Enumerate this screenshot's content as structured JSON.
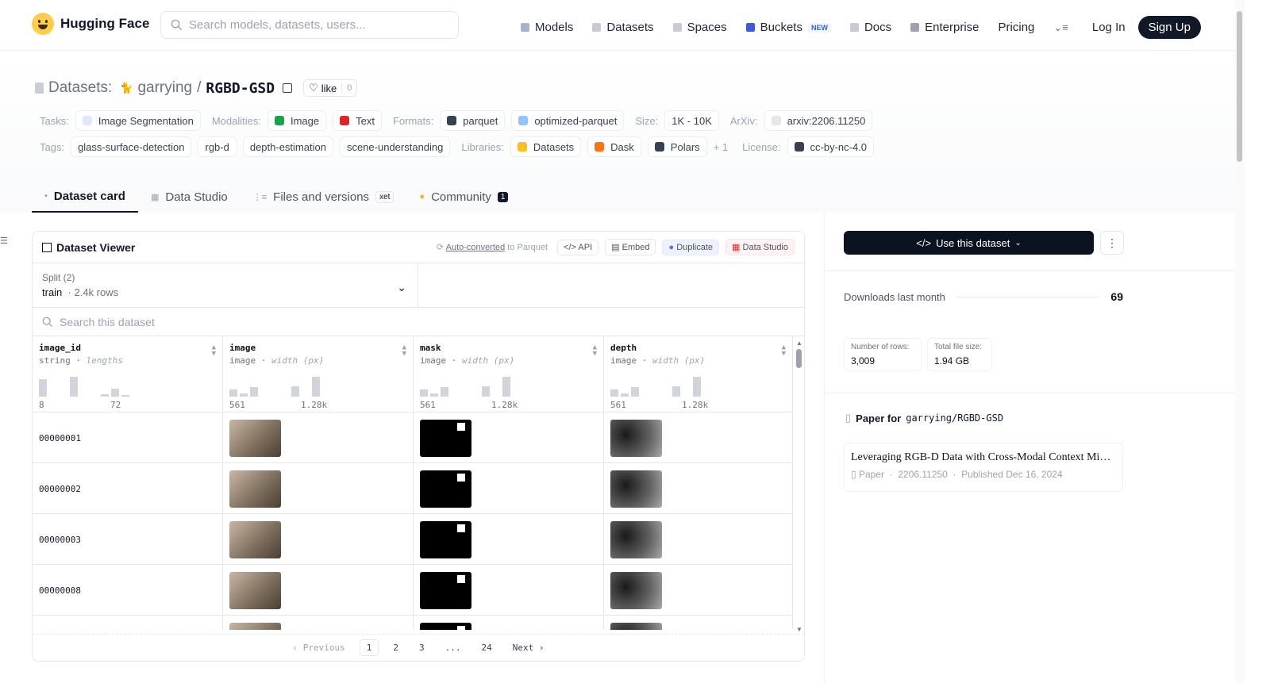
{
  "nav": {
    "brand": "Hugging Face",
    "search_placeholder": "Search models, datasets, users...",
    "links": [
      {
        "label": "Models",
        "icon": "cube-icon",
        "color": "#a5b4c8"
      },
      {
        "label": "Datasets",
        "icon": "database-icon",
        "color": "#c7cbd3"
      },
      {
        "label": "Spaces",
        "icon": "grid-icon",
        "color": "#c7cbd3"
      },
      {
        "label": "Buckets",
        "icon": "bucket-icon",
        "color": "#3b5bdb",
        "badge": "NEW"
      },
      {
        "label": "Docs",
        "icon": "book-icon",
        "color": "#c7cbd3"
      },
      {
        "label": "Enterprise",
        "icon": "briefcase-icon",
        "color": "#9ca3af"
      },
      {
        "label": "Pricing"
      }
    ],
    "more_label": "⌄≡",
    "login": "Log In",
    "signup": "Sign Up"
  },
  "header": {
    "datasets_label": "Datasets:",
    "owner": "garrying",
    "separator": "/",
    "name": "RGBD-GSD",
    "like_label": "like",
    "like_count": "0",
    "row1": [
      {
        "label": "Tasks:",
        "chips": [
          {
            "text": "Image Segmentation",
            "color": "#e0e7ff",
            "icon": "segmentation-icon"
          }
        ]
      },
      {
        "label": "Modalities:",
        "chips": [
          {
            "text": "Image",
            "color": "#16a34a",
            "icon": "image-icon"
          },
          {
            "text": "Text",
            "color": "#dc2626",
            "icon": "text-icon"
          }
        ]
      },
      {
        "label": "Formats:",
        "chips": [
          {
            "text": "parquet",
            "color": "#374151",
            "icon": "parquet-icon"
          },
          {
            "text": "optimized-parquet",
            "color": "#93c5fd",
            "icon": "optimized-parquet-icon"
          }
        ]
      },
      {
        "label": "Size:",
        "chips": [
          {
            "text": "1K - 10K"
          }
        ]
      },
      {
        "label": "ArXiv:",
        "chips": [
          {
            "text": "arxiv:2206.11250",
            "color": "#e5e7eb",
            "icon": "document-icon"
          }
        ]
      }
    ],
    "row2": [
      {
        "label": "Tags:",
        "chips": [
          {
            "text": "glass-surface-detection"
          },
          {
            "text": "rgb-d"
          },
          {
            "text": "depth-estimation"
          },
          {
            "text": "scene-understanding"
          }
        ]
      },
      {
        "label": "Libraries:",
        "chips": [
          {
            "text": "Datasets",
            "color": "#fbbf24",
            "icon": "hf-datasets-icon"
          },
          {
            "text": "Dask",
            "color": "#f97316",
            "icon": "dask-icon"
          },
          {
            "text": "Polars",
            "color": "#374151",
            "icon": "polars-icon"
          }
        ],
        "more": "+ 1"
      },
      {
        "label": "License:",
        "chips": [
          {
            "text": "cc-by-nc-4.0",
            "color": "#374151",
            "icon": "license-icon"
          }
        ]
      }
    ]
  },
  "tabs": [
    {
      "label": "Dataset card",
      "icon": "cube-icon",
      "active": true
    },
    {
      "label": "Data Studio",
      "icon": "table-icon"
    },
    {
      "label": "Files and versions",
      "icon": "files-icon",
      "extra": "xet"
    },
    {
      "label": "Community",
      "icon": "community-icon",
      "badge": "1"
    }
  ],
  "viewer": {
    "title": "Dataset Viewer",
    "auto_converted": "Auto-converted",
    "to_parquet": "to Parquet",
    "buttons": [
      "API",
      "Embed",
      "Duplicate",
      "Data Studio"
    ],
    "split_label": "Split (2)",
    "split_value": "train",
    "split_rows": "2.4k rows",
    "search_placeholder": "Search this dataset",
    "columns": [
      {
        "name": "image_id",
        "type": "string",
        "stat": "lengths",
        "min": "8",
        "max": "72",
        "hist": [
          0.85,
          0,
          0,
          0.95,
          0,
          0,
          0.1,
          0.4,
          0.08
        ]
      },
      {
        "name": "image",
        "type": "image",
        "stat": "width (px)",
        "min": "561",
        "max": "1.28k",
        "hist": [
          0.35,
          0.15,
          0.45,
          0,
          0,
          0,
          0.5,
          0,
          0.95
        ]
      },
      {
        "name": "mask",
        "type": "image",
        "stat": "width (px)",
        "min": "561",
        "max": "1.28k",
        "hist": [
          0.35,
          0.15,
          0.45,
          0,
          0,
          0,
          0.5,
          0,
          0.95
        ]
      },
      {
        "name": "depth",
        "type": "image",
        "stat": "width (px)",
        "min": "561",
        "max": "1.28k",
        "hist": [
          0.35,
          0.15,
          0.45,
          0,
          0,
          0,
          0.5,
          0,
          0.95
        ]
      }
    ],
    "rows": [
      {
        "image_id": "00000001"
      },
      {
        "image_id": "00000002"
      },
      {
        "image_id": "00000003"
      },
      {
        "image_id": "00000008"
      },
      {
        "image_id": ""
      }
    ],
    "pager": {
      "prev": "Previous",
      "pages": [
        "1",
        "2",
        "3",
        "...",
        "24"
      ],
      "current": "1",
      "next": "Next"
    }
  },
  "sidebar": {
    "use_button": "Use this dataset",
    "downloads_label": "Downloads last month",
    "downloads_value": "69",
    "stats": [
      {
        "label": "Number of rows:",
        "value": "3,009"
      },
      {
        "label": "Total file size:",
        "value": "1.94 GB"
      }
    ],
    "paper_heading": "Paper for",
    "paper_repo": "garrying/RGBD-GSD",
    "paper_title": "Leveraging RGB-D Data with Cross-Modal Context Mining for Glass Surface Detection",
    "paper_kind": "Paper",
    "paper_id": "2206.11250",
    "paper_published": "Published Dec 16, 2024"
  }
}
